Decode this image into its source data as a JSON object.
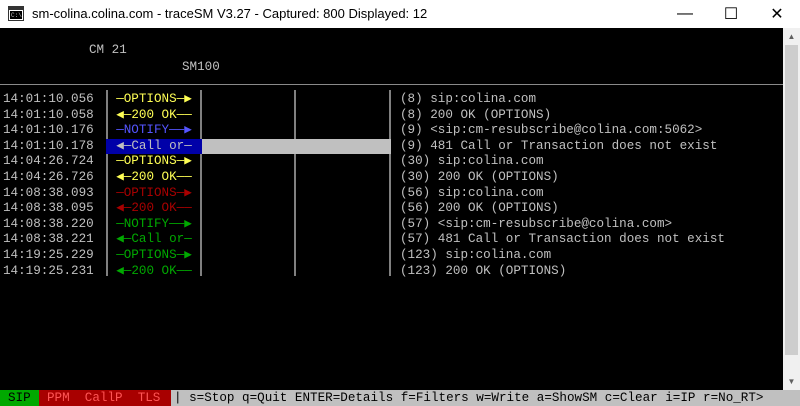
{
  "window": {
    "title": "sm-colina.colina.com - traceSM V3.27 - Captured: 800   Displayed: 12",
    "minimize_glyph": "—",
    "maximize_glyph": "☐",
    "close_glyph": "✕"
  },
  "header": {
    "column1": "CM 21",
    "column2": "SM100"
  },
  "rows": [
    {
      "time": "14:01:10.056",
      "arrow": "—OPTIONS—▶",
      "color": "#ffff55",
      "message": "(8) sip:colina.com"
    },
    {
      "time": "14:01:10.058",
      "arrow": "◀—200 OK——",
      "color": "#ffff55",
      "message": "(8) 200 OK (OPTIONS)"
    },
    {
      "time": "14:01:10.176",
      "arrow": "—NOTIFY——▶",
      "color": "#5555ff",
      "message": "(9) <sip:cm-resubscribe@colina.com:5062>"
    },
    {
      "time": "14:01:10.178",
      "arrow": "◀—Call or—",
      "color": "#5555ff",
      "message": "(9) 481 Call or Transaction does not exist"
    },
    {
      "time": "14:04:26.724",
      "arrow": "—OPTIONS—▶",
      "color": "#ffff55",
      "message": "(30) sip:colina.com"
    },
    {
      "time": "14:04:26.726",
      "arrow": "◀—200 OK——",
      "color": "#ffff55",
      "message": "(30) 200 OK (OPTIONS)"
    },
    {
      "time": "14:08:38.093",
      "arrow": "—OPTIONS—▶",
      "color": "#a80000",
      "message": "(56) sip:colina.com"
    },
    {
      "time": "14:08:38.095",
      "arrow": "◀—200 OK——",
      "color": "#a80000",
      "message": "(56) 200 OK (OPTIONS)"
    },
    {
      "time": "14:08:38.220",
      "arrow": "—NOTIFY——▶",
      "color": "#00a800",
      "message": "(57) <sip:cm-resubscribe@colina.com>"
    },
    {
      "time": "14:08:38.221",
      "arrow": "◀—Call or—",
      "color": "#00a800",
      "message": "(57) 481 Call or Transaction does not exist"
    },
    {
      "time": "14:19:25.229",
      "arrow": "—OPTIONS—▶",
      "color": "#00a800",
      "message": "(123) sip:colina.com"
    },
    {
      "time": "14:19:25.231",
      "arrow": "◀—200 OK——",
      "color": "#00a800",
      "message": "(123) 200 OK (OPTIONS)"
    }
  ],
  "status": {
    "sip": "SIP",
    "filters": "PPM  CallP  TLS",
    "help": "| s=Stop q=Quit ENTER=Details f=Filters w=Write a=ShowSM c=Clear i=IP r=No_RT>"
  },
  "colors": {
    "background": "#000000",
    "text": "#c0c0c0",
    "highlight_row": "#c0c0c0",
    "highlight_cell": "#0000a8",
    "sip_green": "#00a800",
    "filters_red": "#a80000"
  },
  "icons": {
    "app": "terminal-app-icon",
    "scroll_up": "scroll-up-arrow-icon",
    "scroll_down": "scroll-down-arrow-icon"
  }
}
